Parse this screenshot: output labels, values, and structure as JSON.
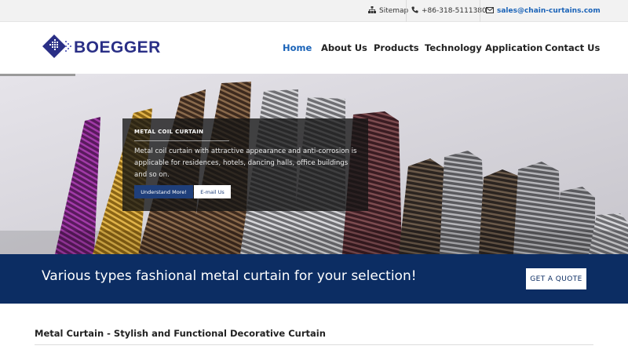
{
  "topbar": {
    "sitemap": "Sitemap",
    "phone": "+86-318-5111380",
    "email": "sales@chain-curtains.com"
  },
  "brand": {
    "name": "BOEGGER",
    "color": "#2a2f86"
  },
  "nav": {
    "items": [
      "Home",
      "About Us",
      "Products",
      "Technology",
      "Application",
      "Contact Us"
    ],
    "active": "Home",
    "active_color": "#1a63b8"
  },
  "slider": {
    "progress": 0.12,
    "caption_title": "METAL COIL CURTAIN",
    "caption_text": "Metal coil curtain with attractive appearance and anti-corrosion is applicable for residences, hotels, dancing halls, office buildings and so on.",
    "primary_button": "Understand More!",
    "secondary_button": "E-mail Us"
  },
  "promo": {
    "text": "Various types fashional metal curtain for your selection!",
    "button": "GET A QUOTE",
    "background": "#0c2d63"
  },
  "section": {
    "title": "Metal Curtain - Stylish and Functional Decorative Curtain"
  },
  "icons": {
    "sitemap": "sitemap-icon",
    "phone": "phone-icon",
    "email": "envelope-icon",
    "logo": "diamond-grid-logo"
  }
}
